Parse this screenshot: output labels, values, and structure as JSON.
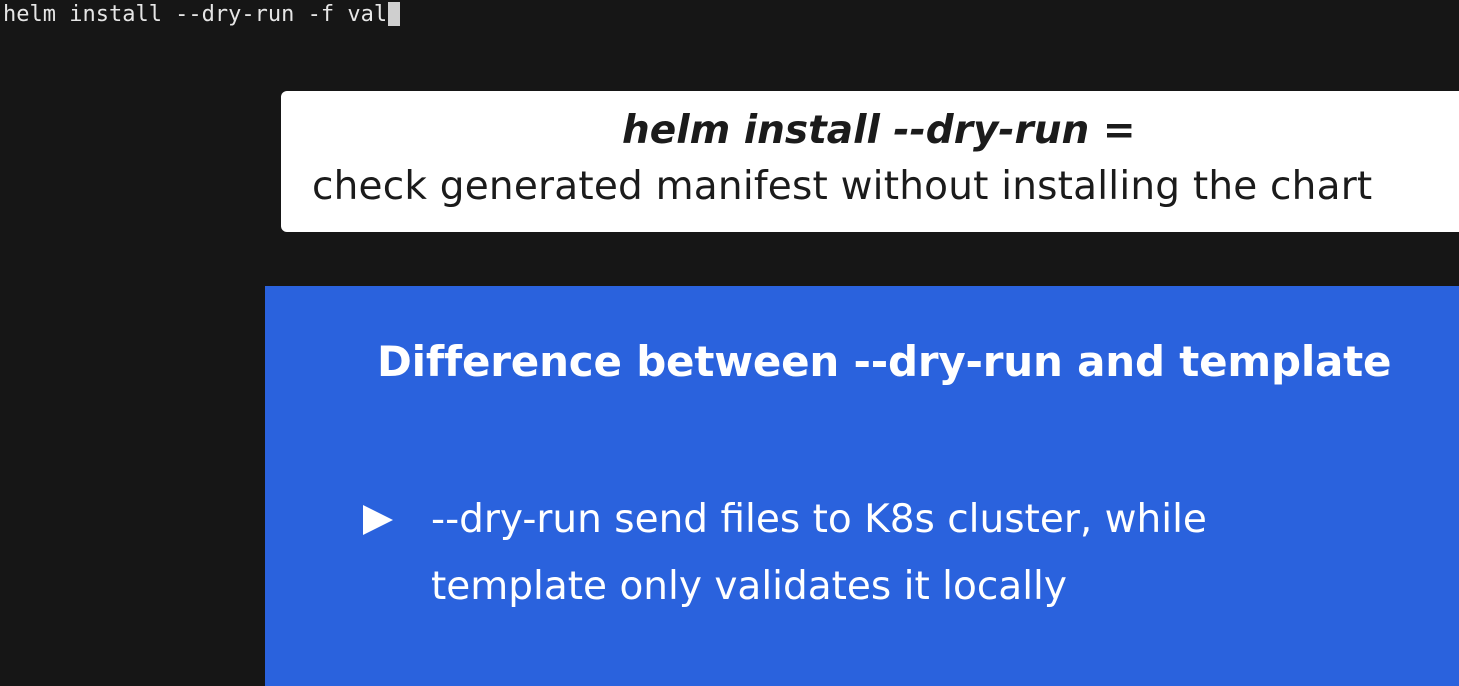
{
  "terminal": {
    "command_text": "helm install --dry-run -f val"
  },
  "card": {
    "title": "helm install --dry-run =",
    "subtitle": "check generated manifest without installing the chart"
  },
  "slide": {
    "heading": "Difference between --dry-run and template",
    "bullet_icon": "play-triangle-icon",
    "bullet_line_1": "--dry-run send files to K8s cluster, while",
    "bullet_line_2": "template only validates it locally"
  },
  "colors": {
    "terminal_bg": "#161616",
    "card_bg": "#ffffff",
    "panel_bg": "#2a62dd",
    "text_dark": "#1b1b1b",
    "text_light": "#ffffff"
  }
}
